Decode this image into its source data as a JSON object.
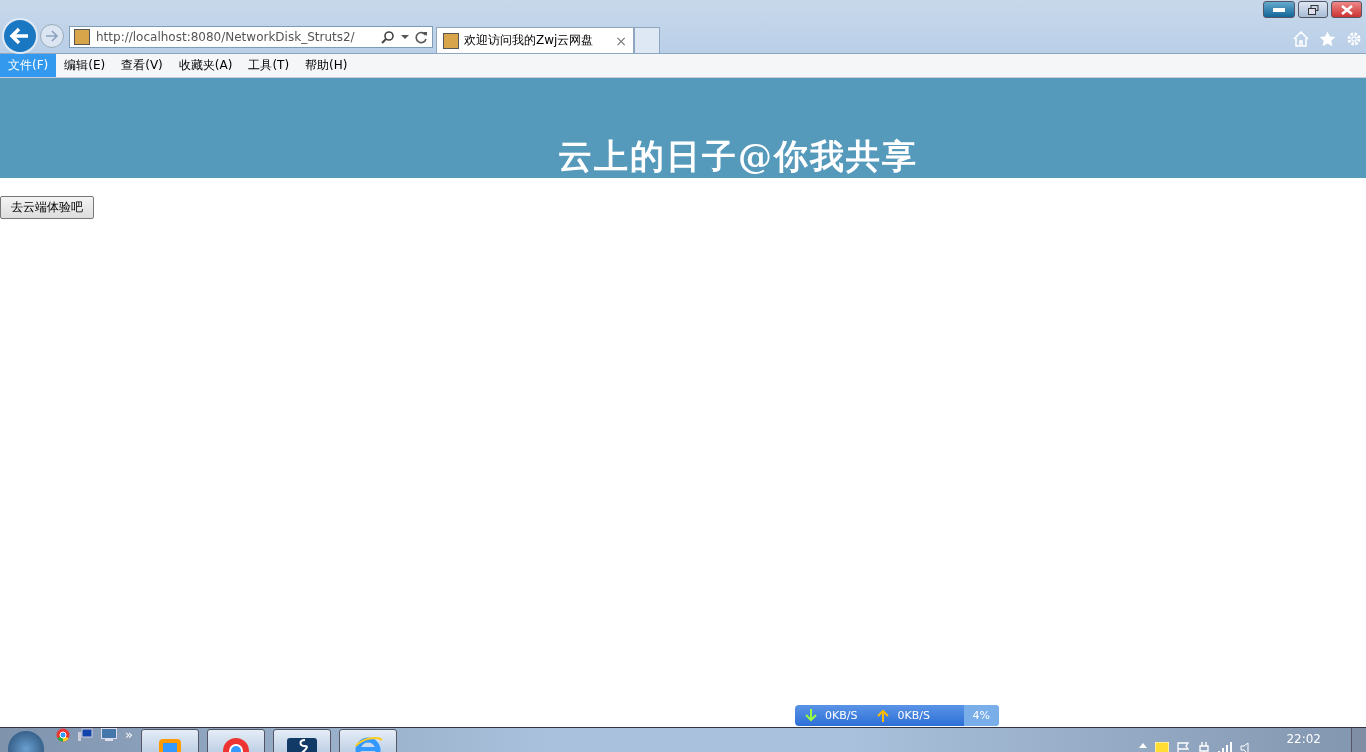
{
  "browser": {
    "address": "http://localhost:8080/NetworkDisk_Struts2/",
    "tab": {
      "title": "欢迎访问我的Zwj云网盘",
      "close": "×"
    }
  },
  "menu": [
    {
      "label": "文件(F)",
      "selected": true
    },
    {
      "label": "编辑(E)",
      "selected": false
    },
    {
      "label": "查看(V)",
      "selected": false
    },
    {
      "label": "收藏夹(A)",
      "selected": false
    },
    {
      "label": "工具(T)",
      "selected": false
    },
    {
      "label": "帮助(H)",
      "selected": false
    }
  ],
  "banner": {
    "title": "云上的日子@你我共享"
  },
  "page": {
    "button": "去云端体验吧"
  },
  "speed_widget": {
    "download": "0KB/S",
    "upload": "0KB/S",
    "usage": "4%"
  },
  "taskbar": {
    "overflow": "»",
    "clock": "22:02"
  }
}
